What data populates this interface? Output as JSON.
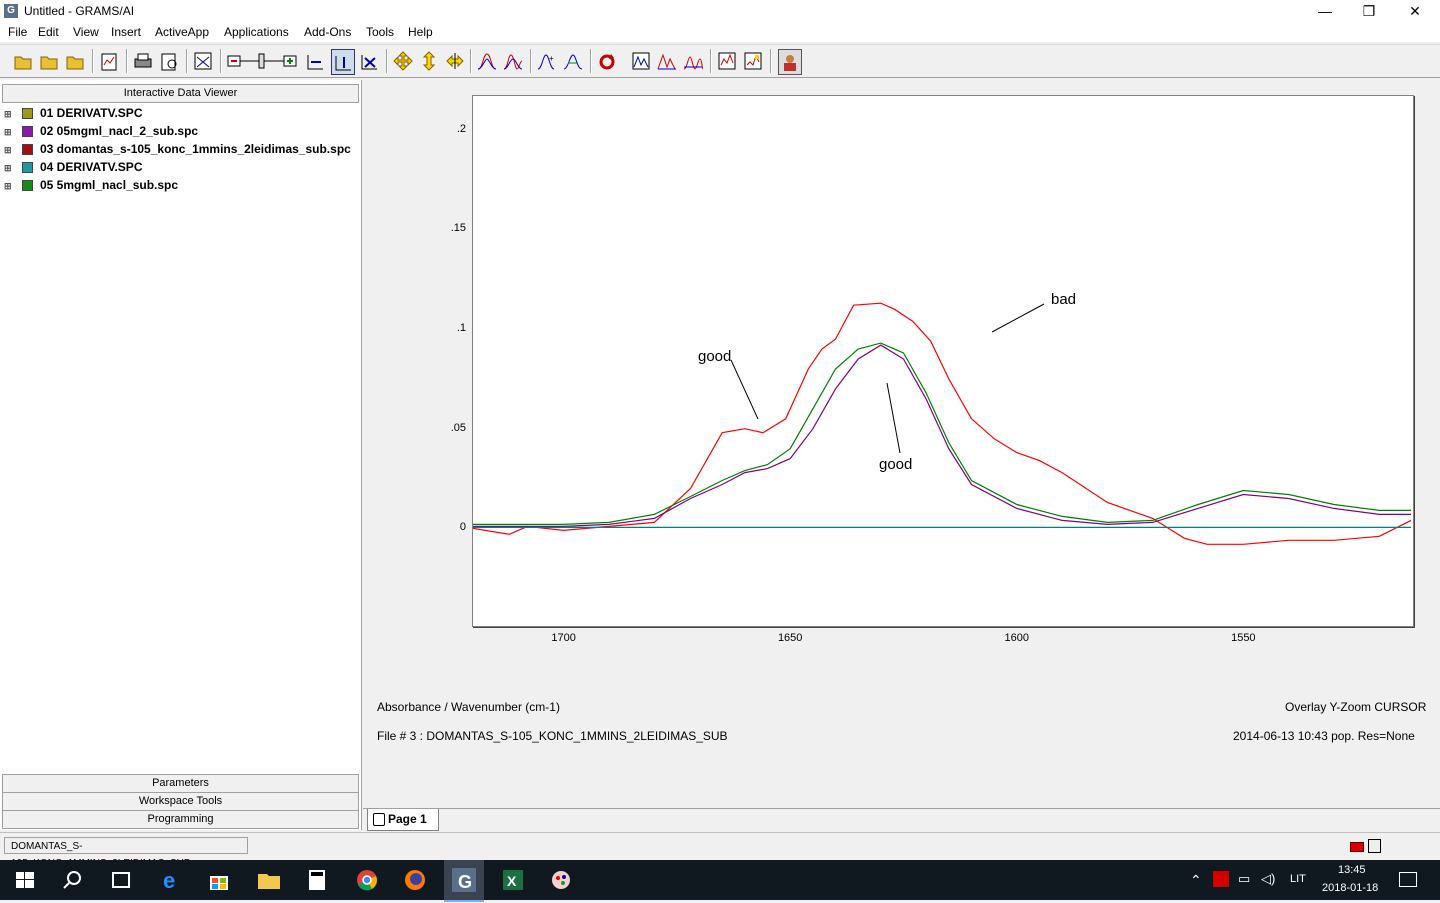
{
  "window": {
    "title": "Untitled - GRAMS/AI",
    "app_icon_letter": "G",
    "min_glyph": "—",
    "max_glyph": "❐",
    "close_glyph": "✕"
  },
  "menu": [
    "File",
    "Edit",
    "View",
    "Insert",
    "ActiveApp",
    "Applications",
    "Add-Ons",
    "Tools",
    "Help"
  ],
  "toolbar_icons": [
    "open-icon",
    "open-folder-icon",
    "open-file-icon",
    "save-page-icon",
    "print-icon",
    "print-preview-icon",
    "zoom-icon",
    "zoom-slider-icon",
    "x-expand-icon",
    "y-expand-icon",
    "xy-expand-icon",
    "move-icon",
    "move-vertical-icon",
    "move-horizontal-icon",
    "peak-icon",
    "peak-multi-icon",
    "peak-label-icon",
    "peak-pick-icon",
    "refresh-icon",
    "spectrum-icon",
    "spectrum-red-icon",
    "spectrum-blue-icon",
    "chart-icon",
    "chart-alt-icon",
    "user-icon"
  ],
  "left_panel": {
    "header": "Interactive Data Viewer",
    "files": [
      {
        "label": "01 DERIVATV.SPC",
        "color": "#9a9a1e"
      },
      {
        "label": "02 05mgml_nacl_2_sub.spc",
        "color": "#8b1aa8"
      },
      {
        "label": "03 domantas_s-105_konc_1mmins_2leidimas_sub.spc",
        "color": "#a01010"
      },
      {
        "label": "04 DERIVATV.SPC",
        "color": "#1e9a9a"
      },
      {
        "label": "05 5mgml_nacl_sub.spc",
        "color": "#1a8a1a"
      }
    ],
    "tabs": [
      "Parameters",
      "Workspace Tools",
      "Programming"
    ]
  },
  "plot": {
    "y_axis_label": "Absorbance / Wavenumber (cm-1)",
    "mode_label": "Overlay Y-Zoom CURSOR",
    "file_info": "File # 3 : DOMANTAS_S-105_KONC_1MMINS_2LEIDIMAS_SUB",
    "date_info": "2014-06-13  10:43 pop.  Res=None",
    "annotations": {
      "bad": "bad",
      "good_left": "good",
      "good_center": "good"
    }
  },
  "chart_data": {
    "type": "line",
    "x_reversed": true,
    "xlim": [
      1720,
      1513
    ],
    "ylim": [
      -0.048,
      0.217
    ],
    "x_ticks": [
      "1700",
      "1650",
      "1600",
      "1550"
    ],
    "x_tick_values": [
      1700,
      1650,
      1600,
      1550
    ],
    "y_ticks": [
      ".2",
      ".15",
      ".1",
      ".05",
      "0"
    ],
    "y_tick_values": [
      0.2,
      0.15,
      0.1,
      0.05,
      0
    ],
    "series": [
      {
        "color": "#ff0000",
        "x": [
          1720,
          1712,
          1708,
          1700,
          1690,
          1680,
          1672,
          1665,
          1660,
          1656,
          1651,
          1646,
          1643,
          1640,
          1636,
          1630,
          1627,
          1623,
          1619,
          1615,
          1610,
          1605,
          1600,
          1595,
          1590,
          1580,
          1570,
          1563,
          1558,
          1550,
          1540,
          1530,
          1520,
          1513
        ],
        "y": [
          0.0,
          -0.003,
          0.001,
          -0.001,
          0.001,
          0.003,
          0.02,
          0.048,
          0.05,
          0.048,
          0.055,
          0.08,
          0.09,
          0.095,
          0.112,
          0.113,
          0.11,
          0.104,
          0.094,
          0.075,
          0.055,
          0.045,
          0.038,
          0.034,
          0.028,
          0.013,
          0.005,
          -0.005,
          -0.008,
          -0.008,
          -0.006,
          -0.006,
          -0.004,
          0.004
        ]
      },
      {
        "color": "#800080",
        "x": [
          1720,
          1700,
          1690,
          1680,
          1672,
          1665,
          1660,
          1655,
          1650,
          1645,
          1640,
          1635,
          1630,
          1625,
          1620,
          1615,
          1610,
          1600,
          1590,
          1580,
          1570,
          1560,
          1550,
          1540,
          1530,
          1520,
          1513
        ],
        "y": [
          0.001,
          0.001,
          0.002,
          0.005,
          0.015,
          0.022,
          0.028,
          0.03,
          0.035,
          0.05,
          0.07,
          0.085,
          0.092,
          0.085,
          0.065,
          0.04,
          0.022,
          0.01,
          0.004,
          0.002,
          0.003,
          0.01,
          0.017,
          0.015,
          0.01,
          0.007,
          0.007
        ]
      },
      {
        "color": "#008000",
        "x": [
          1720,
          1700,
          1690,
          1680,
          1672,
          1665,
          1660,
          1655,
          1650,
          1645,
          1640,
          1635,
          1630,
          1625,
          1620,
          1615,
          1610,
          1600,
          1590,
          1580,
          1570,
          1560,
          1550,
          1540,
          1530,
          1520,
          1513
        ],
        "y": [
          0.002,
          0.002,
          0.003,
          0.007,
          0.016,
          0.024,
          0.029,
          0.032,
          0.04,
          0.06,
          0.08,
          0.09,
          0.093,
          0.088,
          0.068,
          0.043,
          0.024,
          0.012,
          0.006,
          0.003,
          0.004,
          0.012,
          0.019,
          0.017,
          0.012,
          0.009,
          0.009
        ]
      },
      {
        "color": "#008080",
        "x": [
          1720,
          1513
        ],
        "y": [
          0.0005,
          0.0005
        ]
      }
    ]
  },
  "page_tab": {
    "label": "Page 1"
  },
  "status": {
    "current_file": "DOMANTAS_S-105_KONC_1MMINS_2LEIDIMAS_SUB"
  },
  "taskbar": {
    "apps": [
      "start-icon",
      "search-icon",
      "task-view-icon",
      "edge-icon",
      "store-icon",
      "file-explorer-icon",
      "calculator-icon",
      "chrome-icon",
      "firefox-icon",
      "grams-icon",
      "excel-icon",
      "paint-icon"
    ],
    "language": "LIT",
    "time": "13:45",
    "date": "2018-01-18"
  }
}
